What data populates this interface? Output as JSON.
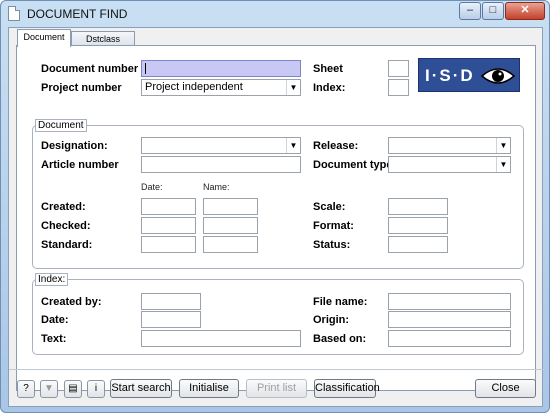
{
  "window": {
    "title": "DOCUMENT FIND",
    "icon": "document-icon"
  },
  "tabs": [
    {
      "label": "Document",
      "active": true
    },
    {
      "label": "Dstclass",
      "active": false
    }
  ],
  "header": {
    "document_number_label": "Document number",
    "document_number_value": "",
    "project_number_label": "Project number",
    "project_number_value": "Project independent",
    "sheet_label": "Sheet",
    "index_label": "Index:",
    "logo_text": "I·S·D"
  },
  "document_group": {
    "legend": "Document",
    "designation_label": "Designation:",
    "article_number_label": "Article number",
    "date_label": "Date:",
    "name_label": "Name:",
    "created_label": "Created:",
    "checked_label": "Checked:",
    "standard_label": "Standard:",
    "release_label": "Release:",
    "document_type_label": "Document type",
    "scale_label": "Scale:",
    "format_label": "Format:",
    "status_label": "Status:"
  },
  "index_group": {
    "legend": "Index:",
    "created_by_label": "Created by:",
    "date_label": "Date:",
    "text_label": "Text:",
    "file_name_label": "File name:",
    "origin_label": "Origin:",
    "based_on_label": "Based on:"
  },
  "buttons": {
    "start_search": "Start search",
    "initialise": "Initialise",
    "print_list": "Print list",
    "classification": "Classification",
    "close": "Close"
  },
  "colors": {
    "focus_field": "#c8c8f4",
    "logo_bg": "#2e4f95",
    "titlebar": "#c9dff3"
  }
}
